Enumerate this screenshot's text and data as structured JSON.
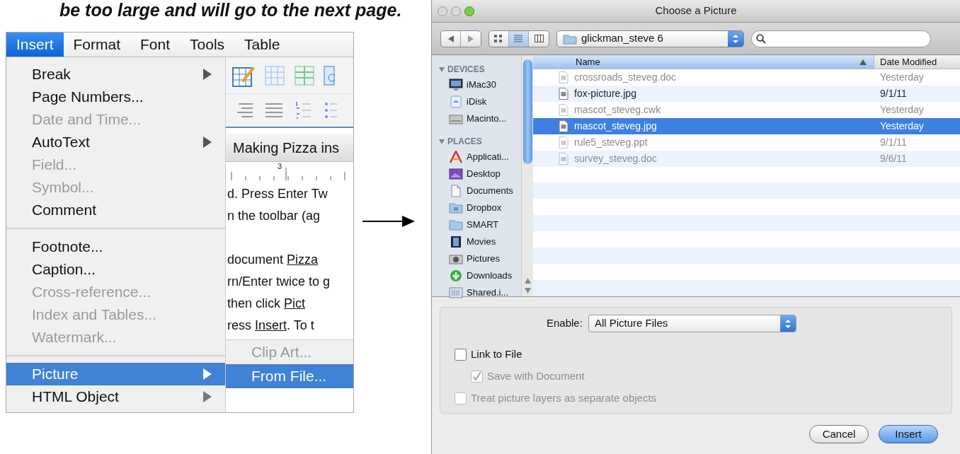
{
  "caption": "be too large and will go to the next page.",
  "word_screenshot": {
    "menubar": [
      {
        "label": "Insert",
        "selected": true
      },
      {
        "label": "Format",
        "selected": false
      },
      {
        "label": "Font",
        "selected": false
      },
      {
        "label": "Tools",
        "selected": false
      },
      {
        "label": "Table",
        "selected": false
      }
    ],
    "menu_items": [
      {
        "kind": "item",
        "label": "Break",
        "disabled": false,
        "submenu": true,
        "selected": false
      },
      {
        "kind": "item",
        "label": "Page Numbers...",
        "disabled": false,
        "submenu": false,
        "selected": false
      },
      {
        "kind": "item",
        "label": "Date and Time...",
        "disabled": true,
        "submenu": false,
        "selected": false
      },
      {
        "kind": "item",
        "label": "AutoText",
        "disabled": false,
        "submenu": true,
        "selected": false
      },
      {
        "kind": "item",
        "label": "Field...",
        "disabled": true,
        "submenu": false,
        "selected": false
      },
      {
        "kind": "item",
        "label": "Symbol...",
        "disabled": true,
        "submenu": false,
        "selected": false
      },
      {
        "kind": "item",
        "label": "Comment",
        "disabled": false,
        "submenu": false,
        "selected": false
      },
      {
        "kind": "separator"
      },
      {
        "kind": "item",
        "label": "Footnote...",
        "disabled": false,
        "submenu": false,
        "selected": false
      },
      {
        "kind": "item",
        "label": "Caption...",
        "disabled": false,
        "submenu": false,
        "selected": false
      },
      {
        "kind": "item",
        "label": "Cross-reference...",
        "disabled": true,
        "submenu": false,
        "selected": false
      },
      {
        "kind": "item",
        "label": "Index and Tables...",
        "disabled": true,
        "submenu": false,
        "selected": false
      },
      {
        "kind": "item",
        "label": "Watermark...",
        "disabled": true,
        "submenu": false,
        "selected": false
      },
      {
        "kind": "separator"
      },
      {
        "kind": "item",
        "label": "Picture",
        "disabled": false,
        "submenu": true,
        "selected": true
      },
      {
        "kind": "item",
        "label": "HTML Object",
        "disabled": false,
        "submenu": true,
        "selected": false
      }
    ],
    "document_title": "Making Pizza ins",
    "ruler_label": "3",
    "document_paragraphs": [
      [
        [
          {
            "text": "d. Press Enter Tw",
            "underline": false
          }
        ],
        [
          {
            "text": "n the toolbar (ag",
            "underline": false
          }
        ]
      ],
      [
        [
          {
            "text": "document ",
            "underline": false
          },
          {
            "text": "Pizza",
            "underline": true
          }
        ],
        [
          {
            "text": "rn/Enter twice to g",
            "underline": false
          }
        ],
        [
          {
            "text": "then click ",
            "underline": false
          },
          {
            "text": "Pict",
            "underline": true
          }
        ],
        [
          {
            "text": "ress ",
            "underline": false
          },
          {
            "text": "Insert",
            "underline": true
          },
          {
            "text": ".  To t",
            "underline": false
          }
        ]
      ]
    ],
    "submenu": [
      {
        "label": "Clip Art...",
        "disabled": true,
        "selected": false
      },
      {
        "label": "From File...",
        "disabled": false,
        "selected": true
      }
    ]
  },
  "dialog": {
    "title": "Choose a Picture",
    "view_modes": [
      {
        "selected": false
      },
      {
        "selected": true
      },
      {
        "selected": false
      }
    ],
    "location": "glickman_steve 6",
    "sidebar": [
      {
        "heading": "DEVICES",
        "items": [
          {
            "label": "iMac30"
          },
          {
            "label": "iDisk"
          },
          {
            "label": "Macinto..."
          }
        ]
      },
      {
        "heading": "PLACES",
        "items": [
          {
            "label": "Applicati..."
          },
          {
            "label": "Desktop"
          },
          {
            "label": "Documents"
          },
          {
            "label": "Dropbox"
          },
          {
            "label": "SMART"
          },
          {
            "label": "Movies"
          },
          {
            "label": "Pictures"
          },
          {
            "label": "Downloads"
          },
          {
            "label": "Shared.i..."
          }
        ]
      }
    ],
    "columns": [
      {
        "label": "Name",
        "sorted": true
      },
      {
        "label": "Date Modified",
        "sorted": false
      }
    ],
    "files": [
      {
        "name": "crossroads_steveg.doc",
        "date": "Yesterday",
        "disabled": true,
        "selected": false
      },
      {
        "name": "fox-picture.jpg",
        "date": "9/1/11",
        "disabled": false,
        "selected": false
      },
      {
        "name": "mascot_steveg.cwk",
        "date": "Yesterday",
        "disabled": true,
        "selected": false
      },
      {
        "name": "mascot_steveg.jpg",
        "date": "Yesterday",
        "disabled": false,
        "selected": true
      },
      {
        "name": "rule5_steveg.ppt",
        "date": "9/1/11",
        "disabled": true,
        "selected": false
      },
      {
        "name": "survey_steveg.doc",
        "date": "9/6/11",
        "disabled": true,
        "selected": false
      }
    ],
    "enable_label": "Enable:",
    "enable_value": "All Picture Files",
    "options": [
      {
        "label": "Link to File",
        "checked": false,
        "disabled": false,
        "indented": false
      },
      {
        "label": "Save with Document",
        "checked": true,
        "disabled": true,
        "indented": true
      },
      {
        "label": "Treat picture layers as separate objects",
        "checked": false,
        "disabled": true,
        "indented": false
      }
    ],
    "buttons": [
      {
        "label": "Cancel",
        "default": false
      },
      {
        "label": "Insert",
        "default": true
      }
    ]
  }
}
